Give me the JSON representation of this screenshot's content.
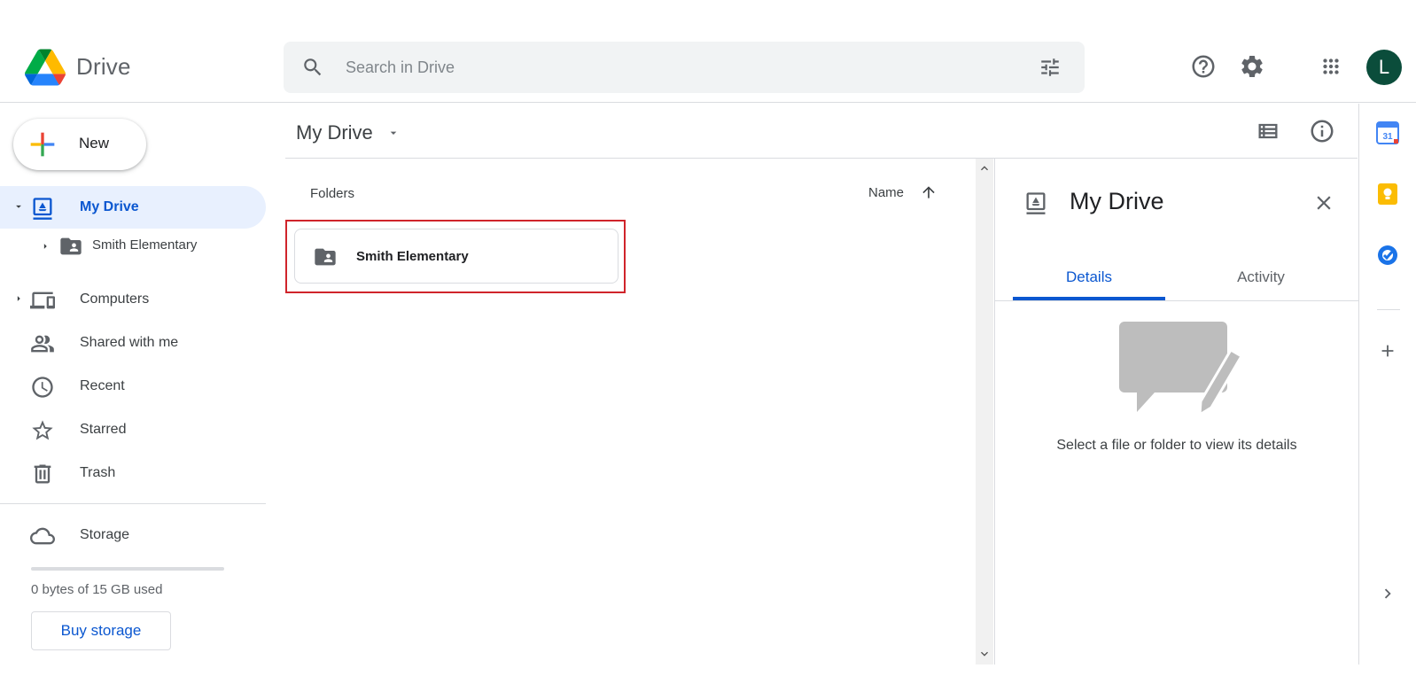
{
  "app": {
    "brand": "Drive"
  },
  "search": {
    "placeholder": "Search in Drive"
  },
  "header": {
    "avatar_initial": "L",
    "avatar_color": "#0b4d3b"
  },
  "new_button": {
    "label": "New"
  },
  "sidebar": {
    "items": [
      {
        "label": "My Drive",
        "icon": "my-drive-icon",
        "active": true,
        "expandable": true
      },
      {
        "label": "Smith Elementary",
        "icon": "shared-folder-icon",
        "indent": true,
        "expandable": true
      },
      {
        "label": "Computers",
        "icon": "computers-icon",
        "expandable": true
      },
      {
        "label": "Shared with me",
        "icon": "people-icon"
      },
      {
        "label": "Recent",
        "icon": "clock-icon"
      },
      {
        "label": "Starred",
        "icon": "star-icon"
      },
      {
        "label": "Trash",
        "icon": "trash-icon"
      }
    ],
    "storage": {
      "label": "Storage",
      "usage_text": "0 bytes of 15 GB used",
      "used_fraction": 0,
      "buy_label": "Buy storage"
    }
  },
  "main": {
    "title": "My Drive",
    "section_label": "Folders",
    "sort_label": "Name",
    "folders": [
      {
        "name": "Smith Elementary",
        "icon": "shared-folder-icon",
        "highlighted": true
      }
    ]
  },
  "details": {
    "title": "My Drive",
    "tabs": [
      {
        "label": "Details",
        "active": true
      },
      {
        "label": "Activity",
        "active": false
      }
    ],
    "empty_text": "Select a file or folder to view its details"
  },
  "rail": {
    "calendar_day": "31",
    "apps": [
      "calendar-icon",
      "keep-icon",
      "tasks-icon",
      "add-icon",
      "expand-icon"
    ]
  },
  "colors": {
    "accent": "#0b57d0",
    "active_nav_bg": "#e8f0fe",
    "highlight_border": "#d0242b"
  }
}
